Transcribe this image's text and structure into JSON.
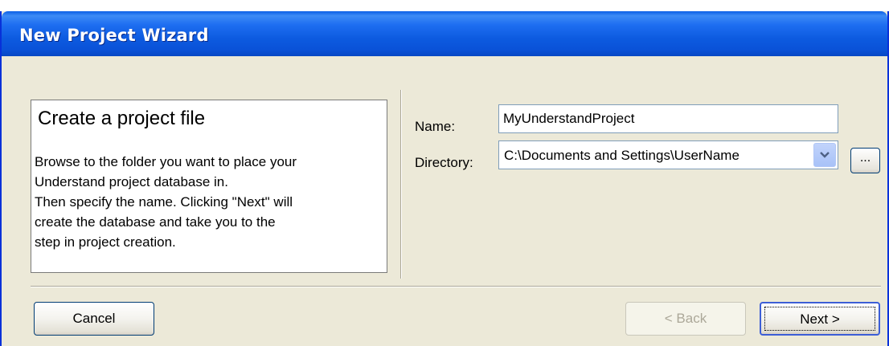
{
  "window": {
    "title": "New Project Wizard",
    "colors": {
      "titlebar": "#0a52d8",
      "face": "#ece9d8",
      "border": "#0831d9"
    }
  },
  "info": {
    "heading": "Create a project file",
    "description": "Browse to the folder you want to place your\nUnderstand project database in.\nThen specify the name. Clicking \"Next\" will\ncreate the database and take you to the\nstep in  project creation."
  },
  "form": {
    "name_label": "Name:",
    "name_value": "MyUnderstandProject",
    "directory_label": "Directory:",
    "directory_value": "C:\\Documents and Settings\\UserName",
    "browse_label": "..."
  },
  "buttons": {
    "cancel": "Cancel",
    "back": "< Back",
    "next": "Next >"
  },
  "icons": {
    "dropdown": "chevron-down-icon"
  }
}
